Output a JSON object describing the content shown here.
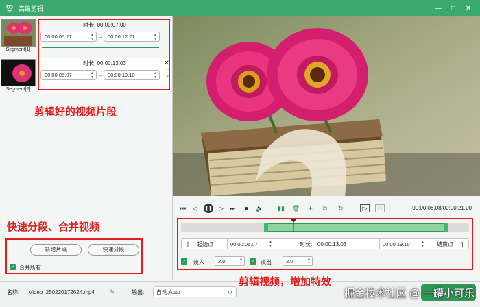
{
  "window": {
    "title": "高级剪辑",
    "minimize": "—",
    "maximize": "□",
    "close": "✕"
  },
  "segments": [
    {
      "caption": "Segment[1]",
      "duration_label": "时长:",
      "duration": "00:00:07.00",
      "start": "00:00:05.21",
      "end": "00:00:12.21"
    },
    {
      "caption": "Segment[2]",
      "duration_label": "时长:",
      "duration": "00:00:13.03",
      "start": "00:00:06.07",
      "end": "00:00:19.10"
    }
  ],
  "annotations": {
    "segments_note": "剪辑好的视频片段",
    "split_note": "快速分段、合并视频",
    "effects_note": "剪辑视频，增加特效"
  },
  "split": {
    "add_segment": "新增片段",
    "quick_split": "快速分段",
    "merge_all": "合并所有"
  },
  "playback": {
    "timecode": "00:00:08.08/00:00:21.00"
  },
  "trim": {
    "start_bracket": "[",
    "start_label": "起始点",
    "start_value": "00:00:06.07",
    "duration_label": "时长:",
    "duration_value": "00:00:13.03",
    "end_value": "00:00:19.10",
    "end_label": "结束点",
    "end_bracket": "]",
    "fade_in_label": "淡入",
    "fade_in_value": "2.0",
    "fade_out_label": "淡出",
    "fade_out_value": "2.0"
  },
  "output": {
    "name_label": "名称:",
    "name_value": "Video_250220172624.mp4",
    "output_label": "输出:",
    "output_value": "自动;Auto"
  },
  "watermark": "掘金技术社区 @ 一罐小可乐",
  "colors": {
    "titlebar": "#3ba96d",
    "accent": "#2e9a58",
    "annotation": "#e11d1d"
  }
}
